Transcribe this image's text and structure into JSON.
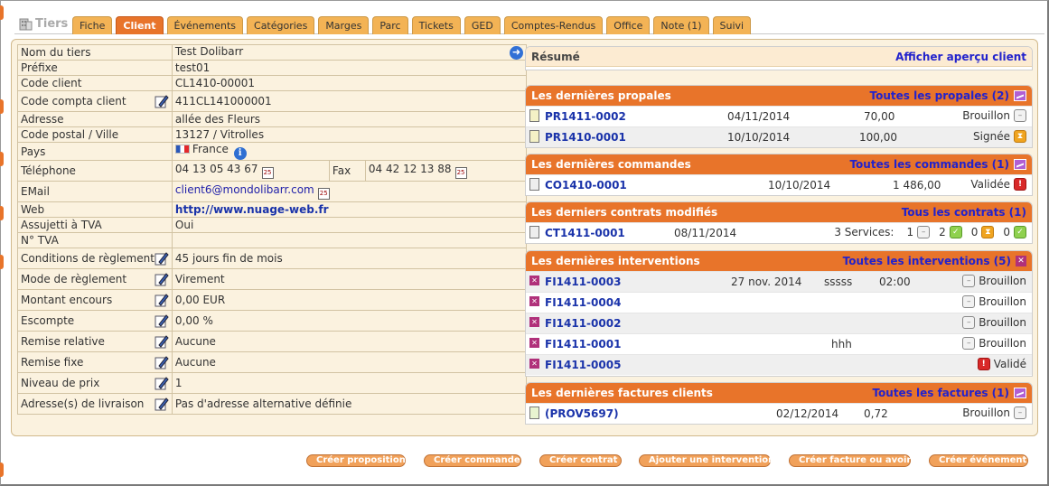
{
  "header": {
    "title": "Tiers"
  },
  "tabs": [
    {
      "label": "Fiche",
      "active": false
    },
    {
      "label": "Client",
      "active": true
    },
    {
      "label": "Événements",
      "active": false
    },
    {
      "label": "Catégories",
      "active": false
    },
    {
      "label": "Marges",
      "active": false
    },
    {
      "label": "Parc",
      "active": false
    },
    {
      "label": "Tickets",
      "active": false
    },
    {
      "label": "GED",
      "active": false
    },
    {
      "label": "Comptes-Rendus",
      "active": false
    },
    {
      "label": "Office",
      "active": false
    },
    {
      "label": "Note (1)",
      "active": false
    },
    {
      "label": "Suivi",
      "active": false
    }
  ],
  "info": {
    "nom_label": "Nom du tiers",
    "nom_value": "Test Dolibarr",
    "prefixe_label": "Préfixe",
    "prefixe_value": "test01",
    "code_client_label": "Code client",
    "code_client_value": "CL1410-00001",
    "compta_label": "Code compta client",
    "compta_value": "411CL141000001",
    "adresse_label": "Adresse",
    "adresse_value": "allée des Fleurs",
    "cp_label": "Code postal / Ville",
    "cp_value": "13127 / Vitrolles",
    "pays_label": "Pays",
    "pays_value": "France",
    "tel_label": "Téléphone",
    "tel_value": "04 13 05 43 67",
    "fax_label": "Fax",
    "fax_value": "04 42 12 13 88",
    "email_label": "EMail",
    "email_value": "client6@mondolibarr.com",
    "web_label": "Web",
    "web_value": "http://www.nuage-web.fr",
    "tva_label": "Assujetti à TVA",
    "tva_value": "Oui",
    "ntva_label": "N° TVA",
    "ntva_value": "",
    "cond_label": "Conditions de règlement",
    "cond_value": "45 jours fin de mois",
    "mode_label": "Mode de règlement",
    "mode_value": "Virement",
    "encours_label": "Montant encours",
    "encours_value": "0,00 EUR",
    "escompte_label": "Escompte",
    "escompte_value": "0,00 %",
    "remrel_label": "Remise relative",
    "remrel_value": "Aucune",
    "remfixe_label": "Remise fixe",
    "remfixe_value": "Aucune",
    "prix_label": "Niveau de prix",
    "prix_value": "1",
    "livraison_label": "Adresse(s) de livraison",
    "livraison_value": "Pas d'adresse alternative définie"
  },
  "resume": {
    "title": "Résumé",
    "link": "Afficher aperçu client"
  },
  "propales": {
    "title": "Les dernières propales",
    "link": "Toutes les propales (2)",
    "rows": [
      {
        "ref": "PR1411-0002",
        "date": "04/11/2014",
        "amount": "70,00",
        "status": "Brouillon"
      },
      {
        "ref": "PR1410-0001",
        "date": "10/10/2014",
        "amount": "100,00",
        "status": "Signée"
      }
    ]
  },
  "commandes": {
    "title": "Les dernières commandes",
    "link": "Toutes les commandes (1)",
    "rows": [
      {
        "ref": "CO1410-0001",
        "date": "10/10/2014",
        "amount": "1 486,00",
        "status": "Validée"
      }
    ]
  },
  "contrats": {
    "title": "Les derniers contrats modifiés",
    "link": "Tous les contrats (1)",
    "rows": [
      {
        "ref": "CT1411-0001",
        "date": "08/11/2014",
        "services": "3 Services:",
        "c1": "1",
        "c2": "2",
        "c3": "0",
        "c4": "0"
      }
    ]
  },
  "interventions": {
    "title": "Les dernières interventions",
    "link": "Toutes les interventions (5)",
    "rows": [
      {
        "ref": "FI1411-0003",
        "date": "27 nov. 2014",
        "desc": "sssss",
        "duration": "02:00",
        "status": "Brouillon"
      },
      {
        "ref": "FI1411-0004",
        "date": "",
        "desc": "",
        "duration": "",
        "status": "Brouillon"
      },
      {
        "ref": "FI1411-0002",
        "date": "",
        "desc": "",
        "duration": "",
        "status": "Brouillon"
      },
      {
        "ref": "FI1411-0001",
        "date": "",
        "desc": "hhh",
        "duration": "",
        "status": "Brouillon"
      },
      {
        "ref": "FI1411-0005",
        "date": "",
        "desc": "",
        "duration": "",
        "status": "Validé"
      }
    ]
  },
  "factures": {
    "title": "Les dernières factures clients",
    "link": "Toutes les factures (1)",
    "rows": [
      {
        "ref": "(PROV5697)",
        "date": "02/12/2014",
        "amount": "0,72",
        "status": "Brouillon"
      }
    ]
  },
  "buttons": {
    "proposition": "Créer proposition",
    "commande": "Créer commande",
    "contrat": "Créer contrat",
    "intervention": "Ajouter une intervention",
    "facture": "Créer facture ou avoir",
    "evenement": "Créer événement"
  },
  "colors": {
    "accent": "#e8742a",
    "tab": "#f3b355",
    "card": "#fbf2df",
    "link": "#1a33aa"
  }
}
